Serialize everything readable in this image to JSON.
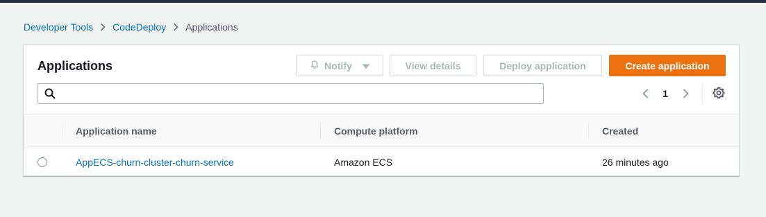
{
  "breadcrumb": {
    "items": [
      "Developer Tools",
      "CodeDeploy"
    ],
    "current": "Applications"
  },
  "panel": {
    "title": "Applications",
    "buttons": {
      "notify": "Notify",
      "view_details": "View details",
      "deploy_application": "Deploy application",
      "create_application": "Create application"
    },
    "search": {
      "value": "",
      "placeholder": ""
    },
    "pagination": {
      "current_page": "1"
    }
  },
  "table": {
    "columns": [
      "Application name",
      "Compute platform",
      "Created"
    ],
    "rows": [
      {
        "application_name": "AppECS-churn-cluster-churn-service",
        "compute_platform": "Amazon ECS",
        "created": "26 minutes ago"
      }
    ]
  },
  "colors": {
    "accent": "#ec7211",
    "link": "#0073bb",
    "topbar": "#232f3e",
    "background": "#f2f3f3"
  },
  "icons": {
    "breadcrumb_separator": "chevron-right-icon",
    "notify": "bell-icon",
    "notify_dropdown": "caret-down-icon",
    "search": "search-icon",
    "pager_prev": "chevron-left-icon",
    "pager_next": "chevron-right-icon",
    "settings": "gear-icon"
  }
}
